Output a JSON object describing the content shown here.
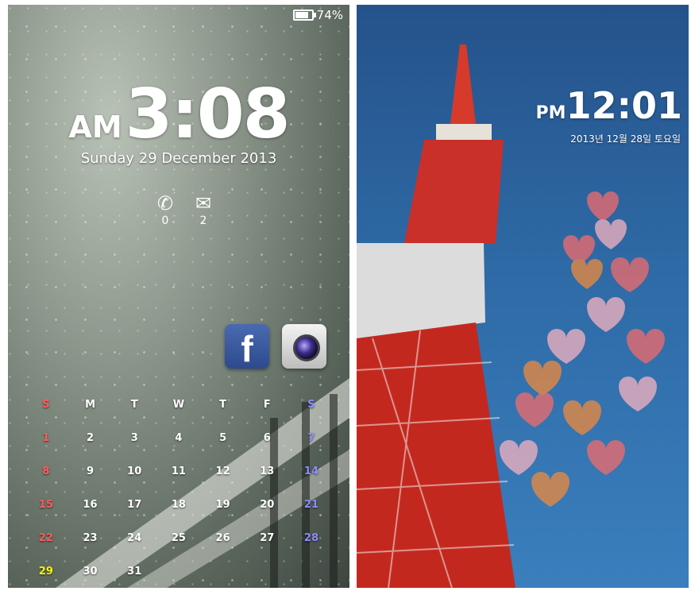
{
  "left_lockscreen": {
    "battery_percent": "74%",
    "battery_level": 0.74,
    "ampm": "AM",
    "time": "3:08",
    "date": "Sunday 29 December 2013",
    "notifications": {
      "calls": {
        "icon": "phone-icon",
        "count": "0"
      },
      "messages": {
        "icon": "mail-icon",
        "count": "2"
      }
    },
    "shortcuts": [
      {
        "label": "f",
        "icon": "facebook-icon"
      },
      {
        "icon": "camera-icon"
      }
    ],
    "calendar": {
      "weekdays": [
        "S",
        "M",
        "T",
        "W",
        "T",
        "F",
        "S"
      ],
      "weeks": [
        [
          "1",
          "2",
          "3",
          "4",
          "5",
          "6",
          "7"
        ],
        [
          "8",
          "9",
          "10",
          "11",
          "12",
          "13",
          "14"
        ],
        [
          "15",
          "16",
          "17",
          "18",
          "19",
          "20",
          "21"
        ],
        [
          "22",
          "23",
          "24",
          "25",
          "26",
          "27",
          "28"
        ],
        [
          "29",
          "30",
          "31",
          "",
          "",
          "",
          ""
        ]
      ],
      "colors": {
        "sunday": "#ff5a5a",
        "saturday": "#8c8cff",
        "today": "#f6f500"
      }
    }
  },
  "right_lockscreen": {
    "ampm": "PM",
    "time": "12:01",
    "date": "2013년 12월 28일 토요일"
  }
}
